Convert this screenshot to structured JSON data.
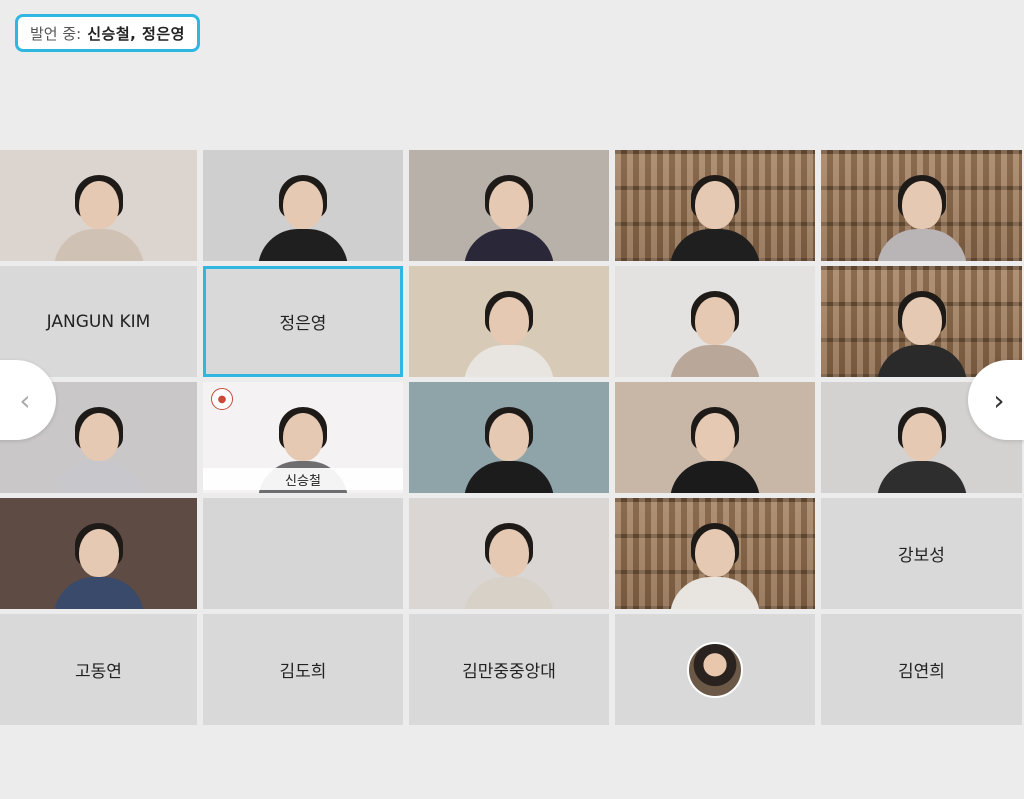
{
  "speaker_banner": {
    "prefix": "발언 중:",
    "names": "신승철,   정은영"
  },
  "participants": [
    {
      "id": "p1",
      "type": "video",
      "bg": "#dcd5cf",
      "shirt": "#cfc2b4"
    },
    {
      "id": "p2",
      "type": "video",
      "bg": "#cfcfcf",
      "shirt": "#1f1f1f"
    },
    {
      "id": "p3",
      "type": "video",
      "bg": "#b8b1a9",
      "shirt": "#2a2838"
    },
    {
      "id": "p4",
      "type": "video",
      "bg": "shelf",
      "shirt": "#1f1f1f"
    },
    {
      "id": "p5",
      "type": "video",
      "bg": "shelf",
      "shirt": "#b9b5b6"
    },
    {
      "id": "p6",
      "type": "name",
      "name": "JANGUN KIM"
    },
    {
      "id": "p7",
      "type": "name",
      "name": "정은영",
      "active": true
    },
    {
      "id": "p8",
      "type": "video",
      "bg": "#d7cbb8",
      "shirt": "#e8e4df"
    },
    {
      "id": "p9",
      "type": "video",
      "bg": "#e4e2e0",
      "shirt": "#b9a79a"
    },
    {
      "id": "p10",
      "type": "video",
      "bg": "shelf",
      "shirt": "#2a2a2a"
    },
    {
      "id": "p11",
      "type": "video",
      "bg": "#c9c7c8",
      "shirt": "#c8c8cc"
    },
    {
      "id": "p12",
      "type": "video-label",
      "name": "신승철",
      "bg": "#f4f2f2",
      "shirt": "#6e6e70",
      "active": true
    },
    {
      "id": "p13",
      "type": "video",
      "bg": "#8ea4a9",
      "shirt": "#1c1c1c"
    },
    {
      "id": "p14",
      "type": "video",
      "bg": "#c8b7a7",
      "shirt": "#1b1b1b"
    },
    {
      "id": "p15",
      "type": "video",
      "bg": "#d4d2d0",
      "shirt": "#2e2e2e"
    },
    {
      "id": "p16",
      "type": "video",
      "bg": "#5e4c44",
      "shirt": "#3a4a6a"
    },
    {
      "id": "p17",
      "type": "blank",
      "bg": "#d6d6d6"
    },
    {
      "id": "p18",
      "type": "video",
      "bg": "#d9d6d3",
      "shirt": "#d8d1c7"
    },
    {
      "id": "p19",
      "type": "video",
      "bg": "shelf",
      "shirt": "#e8e4df"
    },
    {
      "id": "p20",
      "type": "name",
      "name": "강보성"
    },
    {
      "id": "p21",
      "type": "name",
      "name": "고동연"
    },
    {
      "id": "p22",
      "type": "name",
      "name": "김도희"
    },
    {
      "id": "p23",
      "type": "name",
      "name": "김만중중앙대"
    },
    {
      "id": "p24",
      "type": "avatar"
    },
    {
      "id": "p25",
      "type": "name",
      "name": "김연희"
    }
  ],
  "nav": {
    "prev_icon": "chevron-left-icon",
    "next_icon": "chevron-right-icon",
    "prev_glyph": "‹",
    "next_glyph": "›"
  },
  "colors": {
    "active_border": "#2fb7e2",
    "tile_bg": "#d9d9d9",
    "page_bg": "#ececec"
  }
}
